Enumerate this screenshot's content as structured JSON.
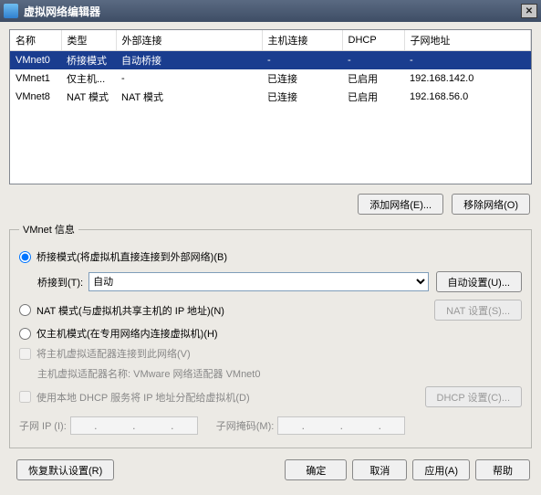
{
  "window": {
    "title": "虚拟网络编辑器",
    "close": "✕"
  },
  "table": {
    "headers": [
      "名称",
      "类型",
      "外部连接",
      "主机连接",
      "DHCP",
      "子网地址"
    ],
    "rows": [
      {
        "name": "VMnet0",
        "type": "桥接模式",
        "ext": "自动桥接",
        "host": "-",
        "dhcp": "-",
        "subnet": "-",
        "selected": true
      },
      {
        "name": "VMnet1",
        "type": "仅主机...",
        "ext": "-",
        "host": "已连接",
        "dhcp": "已启用",
        "subnet": "192.168.142.0",
        "selected": false
      },
      {
        "name": "VMnet8",
        "type": "NAT 模式",
        "ext": "NAT 模式",
        "host": "已连接",
        "dhcp": "已启用",
        "subnet": "192.168.56.0",
        "selected": false
      }
    ]
  },
  "buttons": {
    "add_network": "添加网络(E)...",
    "remove_network": "移除网络(O)"
  },
  "vmnet_info": {
    "legend": "VMnet 信息",
    "radio_bridge": "桥接模式(将虚拟机直接连接到外部网络)(B)",
    "bridge_to_label": "桥接到(T):",
    "bridge_to_value": "自动",
    "auto_settings": "自动设置(U)...",
    "radio_nat": "NAT 模式(与虚拟机共享主机的 IP 地址)(N)",
    "nat_settings": "NAT 设置(S)...",
    "radio_hostonly": "仅主机模式(在专用网络内连接虚拟机)(H)",
    "cb_host_adapter": "将主机虚拟适配器连接到此网络(V)",
    "host_adapter_name": "主机虚拟适配器名称: VMware 网络适配器 VMnet0",
    "cb_local_dhcp": "使用本地 DHCP 服务将 IP 地址分配给虚拟机(D)",
    "dhcp_settings": "DHCP 设置(C)...",
    "subnet_ip_label": "子网 IP (I):",
    "subnet_mask_label": "子网掩码(M):"
  },
  "bottom": {
    "restore_defaults": "恢复默认设置(R)",
    "ok": "确定",
    "cancel": "取消",
    "apply": "应用(A)",
    "help": "帮助"
  }
}
